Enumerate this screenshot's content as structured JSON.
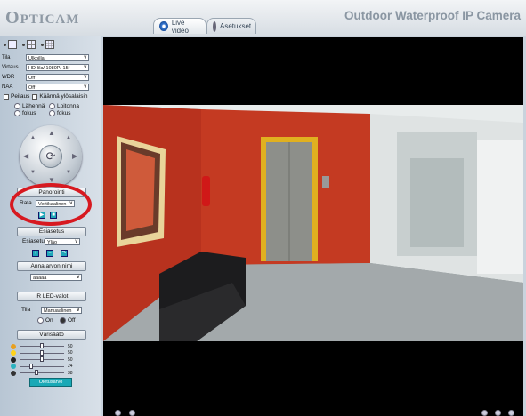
{
  "header": {
    "logo_first": "O",
    "logo_rest": "PTICAM",
    "title": "Outdoor Waterproof IP Camera",
    "tabs": [
      {
        "label": "Live video",
        "icon": "camera-lens-icon",
        "active": true
      },
      {
        "label": "Asetukset",
        "icon": "gear-icon",
        "active": false
      }
    ]
  },
  "sidebar": {
    "settings": [
      {
        "label": "Tila",
        "value": "Ulkoilla"
      },
      {
        "label": "Virtaus",
        "value": "HD-lila/ 1080P/ 15f"
      },
      {
        "label": "WDR",
        "value": "Off"
      },
      {
        "label": "NAA",
        "value": "Off"
      }
    ],
    "checkboxes": [
      {
        "label": "Peilaus"
      },
      {
        "label": "Käännä ylösalaisin"
      }
    ],
    "zoom_focus": {
      "lahenna": "Lähennä",
      "loitonna": "Loitonna",
      "fokus1": "fokus",
      "fokus2": "fokus"
    },
    "patrol": {
      "title": "Panorointi",
      "rata_label": "Rata",
      "rata_value": "Vertikaalinen"
    },
    "preset": {
      "title": "Esiasetus",
      "label": "Esiasetus",
      "value": "Yläo"
    },
    "name_section": {
      "title": "Anna arvon nimi",
      "value": "aaaaa"
    },
    "ir": {
      "title": "IR LED-valot",
      "tila_label": "Tila",
      "tila_value": "Manuaalinen",
      "on_label": "On",
      "off_label": "Off"
    },
    "color": {
      "title": "Värisäätö",
      "sliders": [
        {
          "icon": "brightness-icon",
          "color": "#e8a020",
          "value": 50,
          "level": 0.5
        },
        {
          "icon": "contrast-icon",
          "color": "#ffd31a",
          "value": 50,
          "level": 0.5
        },
        {
          "icon": "saturation-icon",
          "color": "#222222",
          "value": 50,
          "level": 0.5
        },
        {
          "icon": "hue-icon",
          "color": "#2bb2bf",
          "value": 24,
          "level": 0.24
        },
        {
          "icon": "sharpness-icon",
          "color": "#333333",
          "value": 38,
          "level": 0.38
        }
      ],
      "default_button": "Oletusarvo"
    }
  }
}
